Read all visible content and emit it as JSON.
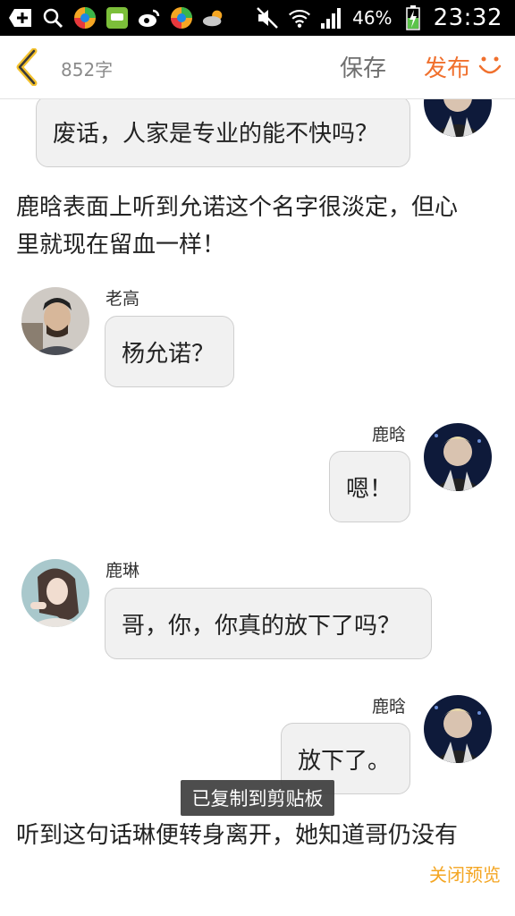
{
  "status_bar": {
    "battery": "46%",
    "time": "23:32"
  },
  "header": {
    "word_count": "852字",
    "save_label": "保存",
    "publish_label": "发布"
  },
  "messages": [
    {
      "text": "废话，人家是专业的能不快吗？"
    },
    {
      "name": "老高",
      "text": "杨允诺？"
    },
    {
      "name": "鹿晗",
      "text": "嗯！"
    },
    {
      "name": "鹿琳",
      "text": "哥，你，你真的放下了吗？"
    },
    {
      "name": "鹿晗",
      "text": "放下了。"
    }
  ],
  "narration": {
    "line1": "鹿晗表面上听到允诺这个名字很淡定，但心",
    "line2": "里就现在留血一样！",
    "bottom_line": "听到这句话琳便转身离开，她知道哥仍没有"
  },
  "toast": "已复制到剪贴板",
  "close_preview": "关闭预览",
  "colors": {
    "accent": "#f0702d",
    "close_preview": "#f4a623",
    "bubble_bg": "#f1f1f1"
  }
}
